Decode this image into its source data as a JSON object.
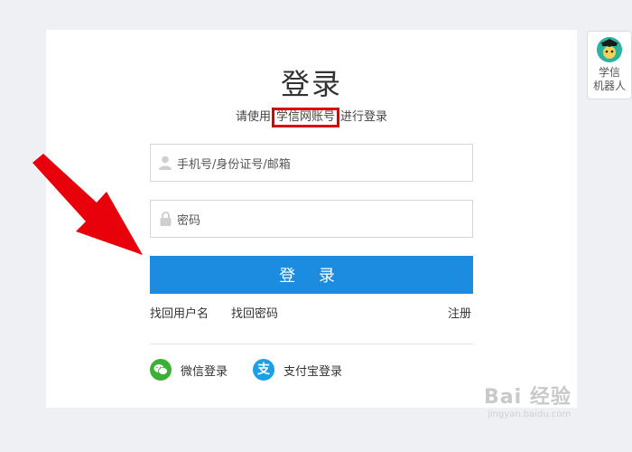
{
  "login": {
    "title": "登录",
    "subtitle_before": "请使用",
    "subtitle_highlight": "学信网账号",
    "subtitle_after": "进行登录",
    "account_placeholder": "手机号/身份证号/邮箱",
    "password_placeholder": "密码",
    "submit_label": "登 录"
  },
  "links": {
    "find_username": "找回用户名",
    "find_password": "找回密码",
    "register": "注册"
  },
  "social": {
    "wechat_label": "微信登录",
    "alipay_label": "支付宝登录"
  },
  "robot": {
    "line1": "学信",
    "line2": "机器人"
  },
  "watermark": {
    "main": "Bai 经验",
    "sub": "jingyan.baidu.com"
  },
  "colors": {
    "accent": "#1b8ce0",
    "highlight_box": "#e00000",
    "arrow": "#e8000a",
    "wechat": "#3cb034",
    "alipay": "#1a9fe8"
  },
  "icons": {
    "account": "user-icon",
    "password": "lock-icon",
    "wechat": "wechat-icon",
    "alipay": "alipay-icon",
    "robot": "robot-avatar"
  }
}
